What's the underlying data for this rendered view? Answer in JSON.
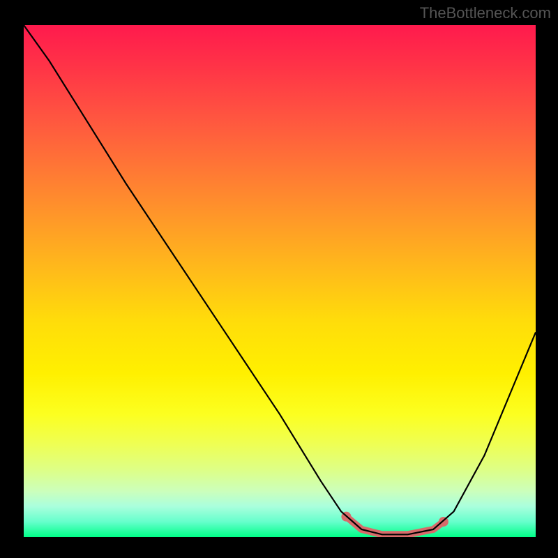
{
  "attribution": "TheBottleneck.com",
  "chart_data": {
    "type": "line",
    "title": "",
    "xlabel": "",
    "ylabel": "",
    "xlim": [
      0,
      100
    ],
    "ylim": [
      0,
      100
    ],
    "curve": {
      "name": "bottleneck-curve",
      "points": [
        {
          "x": 0,
          "y": 100
        },
        {
          "x": 5,
          "y": 93
        },
        {
          "x": 10,
          "y": 85
        },
        {
          "x": 20,
          "y": 69
        },
        {
          "x": 30,
          "y": 54
        },
        {
          "x": 40,
          "y": 39
        },
        {
          "x": 50,
          "y": 24
        },
        {
          "x": 58,
          "y": 11
        },
        {
          "x": 62,
          "y": 5
        },
        {
          "x": 66,
          "y": 1.5
        },
        {
          "x": 70,
          "y": 0.5
        },
        {
          "x": 75,
          "y": 0.5
        },
        {
          "x": 80,
          "y": 1.5
        },
        {
          "x": 84,
          "y": 5
        },
        {
          "x": 90,
          "y": 16
        },
        {
          "x": 95,
          "y": 28
        },
        {
          "x": 100,
          "y": 40
        }
      ]
    },
    "highlight": {
      "name": "optimal-range",
      "color": "#d86a6a",
      "x_start": 63,
      "x_end": 82,
      "points": [
        {
          "x": 63,
          "y": 4
        },
        {
          "x": 66,
          "y": 1.5
        },
        {
          "x": 70,
          "y": 0.5
        },
        {
          "x": 75,
          "y": 0.5
        },
        {
          "x": 80,
          "y": 1.5
        },
        {
          "x": 82,
          "y": 3
        }
      ]
    },
    "background_gradient": {
      "top": "#ff1a4d",
      "mid": "#fff000",
      "bottom": "#00ff88"
    }
  }
}
